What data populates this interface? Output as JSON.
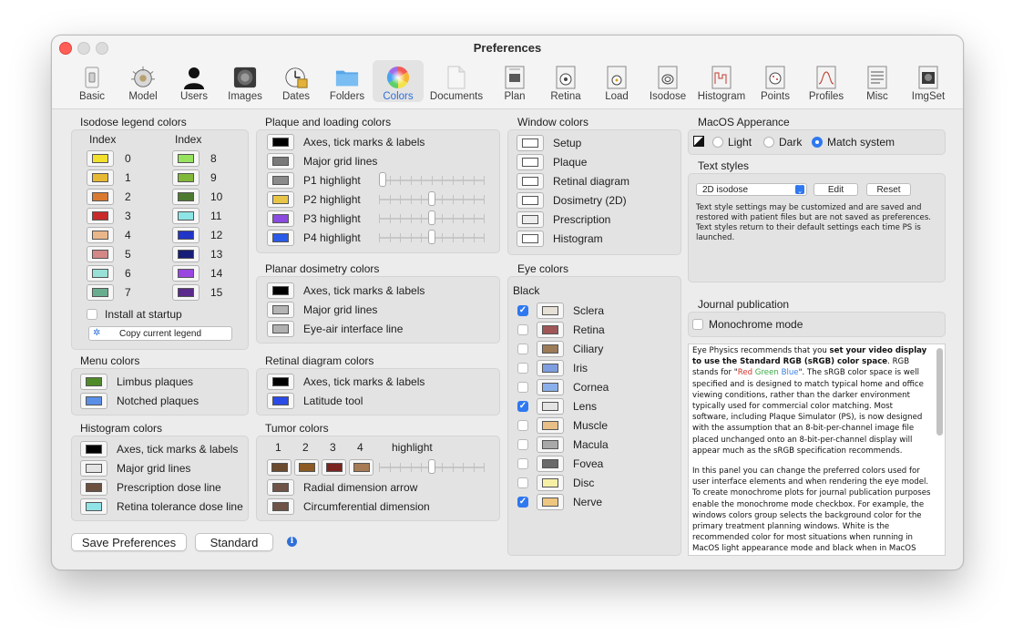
{
  "window": {
    "title": "Preferences"
  },
  "toolbar": [
    {
      "label": "Basic",
      "icon": "switch-icon"
    },
    {
      "label": "Model",
      "icon": "eye-model-icon"
    },
    {
      "label": "Users",
      "icon": "user-icon"
    },
    {
      "label": "Images",
      "icon": "images-icon"
    },
    {
      "label": "Dates",
      "icon": "clock-icon"
    },
    {
      "label": "Folders",
      "icon": "folder-icon"
    },
    {
      "label": "Colors",
      "icon": "color-wheel-icon"
    },
    {
      "label": "Documents",
      "icon": "document-icon"
    },
    {
      "label": "Plan",
      "icon": "plan-icon"
    },
    {
      "label": "Retina",
      "icon": "retina-icon"
    },
    {
      "label": "Load",
      "icon": "load-icon"
    },
    {
      "label": "Isodose",
      "icon": "isodose-icon"
    },
    {
      "label": "Histogram",
      "icon": "histogram-icon"
    },
    {
      "label": "Points",
      "icon": "points-icon"
    },
    {
      "label": "Profiles",
      "icon": "profiles-icon"
    },
    {
      "label": "Misc",
      "icon": "misc-icon"
    },
    {
      "label": "ImgSet",
      "icon": "imgset-icon"
    }
  ],
  "selected_tab": "Colors",
  "isodose": {
    "title": "Isodose legend colors",
    "index_header": "Index",
    "left": [
      {
        "n": "0",
        "color": "#f2e02c"
      },
      {
        "n": "1",
        "color": "#e8b935"
      },
      {
        "n": "2",
        "color": "#d97a30"
      },
      {
        "n": "3",
        "color": "#c8292a"
      },
      {
        "n": "4",
        "color": "#e9b68a"
      },
      {
        "n": "5",
        "color": "#d38787"
      },
      {
        "n": "6",
        "color": "#99e0d6"
      },
      {
        "n": "7",
        "color": "#68ad8e"
      }
    ],
    "right": [
      {
        "n": "8",
        "color": "#97e25e"
      },
      {
        "n": "9",
        "color": "#82b83a"
      },
      {
        "n": "10",
        "color": "#4d7a2f"
      },
      {
        "n": "11",
        "color": "#8de6e5"
      },
      {
        "n": "12",
        "color": "#2135c7"
      },
      {
        "n": "13",
        "color": "#171e78"
      },
      {
        "n": "14",
        "color": "#9a45e2"
      },
      {
        "n": "15",
        "color": "#5a2a8c"
      }
    ],
    "install_label": "Install at startup",
    "install_checked": false,
    "copy_label": "Copy current legend"
  },
  "menu": {
    "title": "Menu colors",
    "items": [
      {
        "label": "Limbus plaques",
        "color": "#4f8a2a"
      },
      {
        "label": "Notched plaques",
        "color": "#5b8ee6"
      }
    ]
  },
  "histogram": {
    "title": "Histogram colors",
    "items": [
      {
        "label": "Axes, tick marks & labels",
        "color": "#000000"
      },
      {
        "label": "Major grid lines",
        "color": "#e4e4e4"
      },
      {
        "label": "Prescription dose line",
        "color": "#6b4f3f"
      },
      {
        "label": "Retina tolerance dose line",
        "color": "#90e3e7"
      }
    ]
  },
  "plaque": {
    "title": "Plaque and loading colors",
    "items": [
      {
        "label": "Axes, tick marks & labels",
        "color": "#000000"
      },
      {
        "label": "Major grid lines",
        "color": "#7a7a7a"
      },
      {
        "label": "P1 highlight",
        "color": "#8a8a8a",
        "level": 0.0
      },
      {
        "label": "P2 highlight",
        "color": "#e8c547",
        "level": 0.5
      },
      {
        "label": "P3 highlight",
        "color": "#8b4ae0",
        "level": 0.5
      },
      {
        "label": "P4 highlight",
        "color": "#2a5ae8",
        "level": 0.5
      }
    ]
  },
  "planar": {
    "title": "Planar dosimetry colors",
    "items": [
      {
        "label": "Axes, tick marks & labels",
        "color": "#000000"
      },
      {
        "label": "Major grid lines",
        "color": "#b4b4b4"
      },
      {
        "label": "Eye-air interface line",
        "color": "#b0b0b0"
      }
    ]
  },
  "retinal": {
    "title": "Retinal diagram colors",
    "items": [
      {
        "label": "Axes, tick marks & labels",
        "color": "#000000"
      },
      {
        "label": "Latitude tool",
        "color": "#2a4be6"
      }
    ]
  },
  "tumor": {
    "title": "Tumor colors",
    "headers": [
      "1",
      "2",
      "3",
      "4"
    ],
    "highlight_label": "highlight",
    "swatches": [
      "#6b4a2e",
      "#8c5a22",
      "#7a2420",
      "#a77b55"
    ],
    "highlight_level": 0.5,
    "items": [
      {
        "label": "Radial dimension arrow",
        "color": "#6e5346"
      },
      {
        "label": "Circumferential dimension",
        "color": "#6e5346"
      }
    ]
  },
  "windowc": {
    "title": "Window colors",
    "items": [
      {
        "label": "Setup",
        "color": "#ffffff"
      },
      {
        "label": "Plaque",
        "color": "#ffffff"
      },
      {
        "label": "Retinal diagram",
        "color": "#ffffff"
      },
      {
        "label": "Dosimetry (2D)",
        "color": "#ffffff"
      },
      {
        "label": "Prescription",
        "color": "#ececec"
      },
      {
        "label": "Histogram",
        "color": "#ffffff"
      }
    ]
  },
  "eye": {
    "title": "Eye colors",
    "background_label": "Black",
    "items": [
      {
        "label": "Sclera",
        "color": "#e6e0d6",
        "checked": true
      },
      {
        "label": "Retina",
        "color": "#a05656",
        "checked": false
      },
      {
        "label": "Ciliary",
        "color": "#9b7b58",
        "checked": false
      },
      {
        "label": "Iris",
        "color": "#7f9ee0",
        "checked": false
      },
      {
        "label": "Cornea",
        "color": "#8ab0ea",
        "checked": false
      },
      {
        "label": "Lens",
        "color": "#e3e3e3",
        "checked": true
      },
      {
        "label": "Muscle",
        "color": "#e8bf86",
        "checked": false
      },
      {
        "label": "Macula",
        "color": "#a9a9a9",
        "checked": false
      },
      {
        "label": "Fovea",
        "color": "#6a6a6a",
        "checked": false
      },
      {
        "label": "Disc",
        "color": "#f5f0a6",
        "checked": false
      },
      {
        "label": "Nerve",
        "color": "#edc67f",
        "checked": true
      }
    ]
  },
  "appearance": {
    "title": "MacOS Apperance",
    "options": [
      "Light",
      "Dark",
      "Match system"
    ],
    "selected": "Match system"
  },
  "textstyles": {
    "title": "Text styles",
    "select_value": "2D isodose",
    "edit_label": "Edit",
    "reset_label": "Reset",
    "description": "Text style settings may be customized and are saved and restored with patient files but are not saved as preferences. Text styles return to their default settings each time PS is launched."
  },
  "journal": {
    "title": "Journal publication",
    "mono_label": "Monochrome mode",
    "mono_checked": false,
    "p1_a": "Eye Physics recommends that you ",
    "p1_bold": "set your video display to use the Standard RGB (sRGB) color space",
    "p1_b": ". RGB stands for \"",
    "red": "Red",
    "green": "Green",
    "blue": "Blue",
    "p1_c": "\". The sRGB color space is well specified and is designed to match typical home and office viewing conditions, rather than the darker environment typically used for commercial color matching. Most software, including Plaque Simulator (PS), is now designed with the assumption that an 8-bit-per-channel image file placed unchanged onto an 8-bit-per-channel display will appear much as the sRGB specification recommends.",
    "p2": "In this panel you can change the preferred colors used for user interface elements and when rendering the eye model. To create monochrome plots for journal publication purposes enable the monochrome mode checkbox. For example, the windows colors group selects the background color for the primary treatment planning windows. White is the recommended color for most situations when running in MacOS light appearance mode and black when in MacOS dark appearance mode. Most"
  },
  "footer": {
    "save_label": "Save Preferences",
    "standard_label": "Standard"
  }
}
